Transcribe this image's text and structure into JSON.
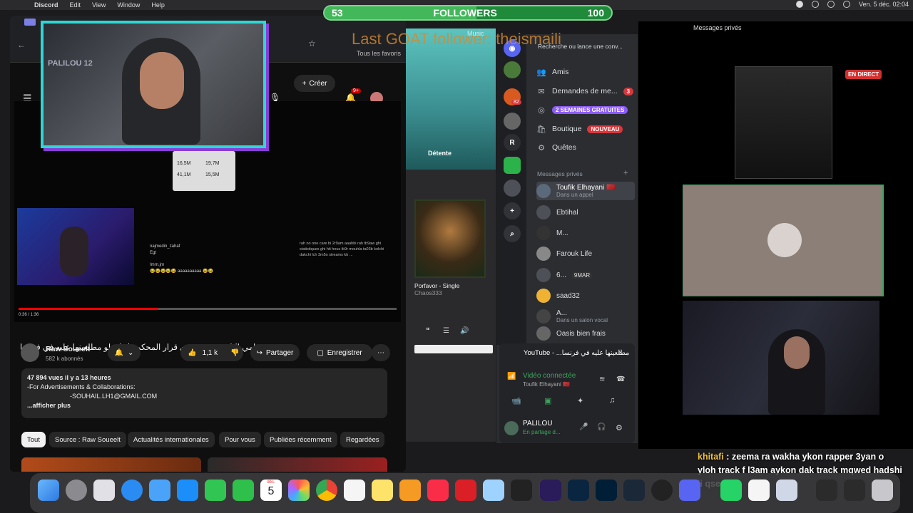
{
  "menubar": {
    "app": "Discord",
    "items": [
      "Edit",
      "View",
      "Window",
      "Help"
    ],
    "clock": "Ven. 5 déc. 02:04"
  },
  "followers": {
    "current": "53",
    "label": "FOLLOWERS",
    "goal": "100",
    "progress": 0.53
  },
  "last_goat": "Last GOAT follower: theismaili",
  "browser": {
    "bookmarks_label": "Tous les favoris",
    "create_label": "Créer",
    "notif_count": "9+"
  },
  "webcam": {
    "shirt_text": "PALILOU 12"
  },
  "youtube": {
    "title": "محامي إلياس مصدوم من قرار المحكمة | طوطو مطلعينها عليه في فرنسا",
    "channel": "Raw Soueelt",
    "subscribers": "582 k abonnés",
    "likes": "1,1 k",
    "share_label": "Partager",
    "save_label": "Enregistrer",
    "views": "47 894 vues  il y a 13 heures",
    "desc_line1": "-For Advertisements & Collaborations:",
    "desc_line2": "-SOUHAIL.LH1@GMAIL.COM",
    "more": "...afficher plus",
    "time": "0:36 / 1:36",
    "chips": [
      "Tout",
      "Source : Raw Soueelt",
      "Actualités internationales",
      "Pour vous",
      "Publiées récemment",
      "Regardées"
    ],
    "stats": [
      "16,5M",
      "19,7M",
      "41,1M",
      "15,5M"
    ]
  },
  "music": {
    "apple_label": "Music",
    "detente": "Détente",
    "album_title": "Porfavor - Single",
    "album_artist": "Chaos333"
  },
  "discord": {
    "search_placeholder": "Recherche ou lance une conv...",
    "nav": [
      {
        "label": "Amis"
      },
      {
        "label": "Demandes de me...",
        "badge": "3"
      },
      {
        "label": "",
        "badge": "2 SEMAINES GRATUITES"
      },
      {
        "label": "Boutique",
        "badge": "NOUVEAU"
      },
      {
        "label": "Quêtes"
      }
    ],
    "dm_header": "Messages privés",
    "dms": [
      {
        "name": "Toufik Elhayani 🇲🇦",
        "sub": "Dans un appel"
      },
      {
        "name": "Ebtihal",
        "sub": ""
      },
      {
        "name": "M...",
        "sub": ""
      },
      {
        "name": "Farouk Life",
        "sub": ""
      },
      {
        "name": "6...",
        "sub": "",
        "tag": "9MAR"
      },
      {
        "name": "saad32",
        "sub": ""
      },
      {
        "name": "A...",
        "sub": "Dans un salon vocal"
      },
      {
        "name": "Oasis bien frais",
        "sub": ""
      }
    ],
    "server_badge": "82",
    "activity": "YouTube - ...مطلعينها عليه في فرنسا",
    "video_status": "Vidéo connectée",
    "video_user": "Toufik Elhayani 🇲🇦",
    "user_name": "PALILOU",
    "user_status": "En partage d...",
    "window_title": "Messages privés"
  },
  "stream": {
    "live": "EN DIRECT"
  },
  "chat": {
    "user": "khitafi",
    "message": "zeema ra wakha ykon rapper 3yan o yloh track f l3am aykon dak track mqwed hadshi li qsedt"
  },
  "dock": {
    "calendar_day": "5",
    "calendar_month": "déc."
  },
  "colors": {
    "discord_bg": "#2b2d31",
    "follower_green": "#1f8a3a",
    "webcam_border": "#2fd6d6",
    "webcam_shadow": "#8a3bd8"
  }
}
